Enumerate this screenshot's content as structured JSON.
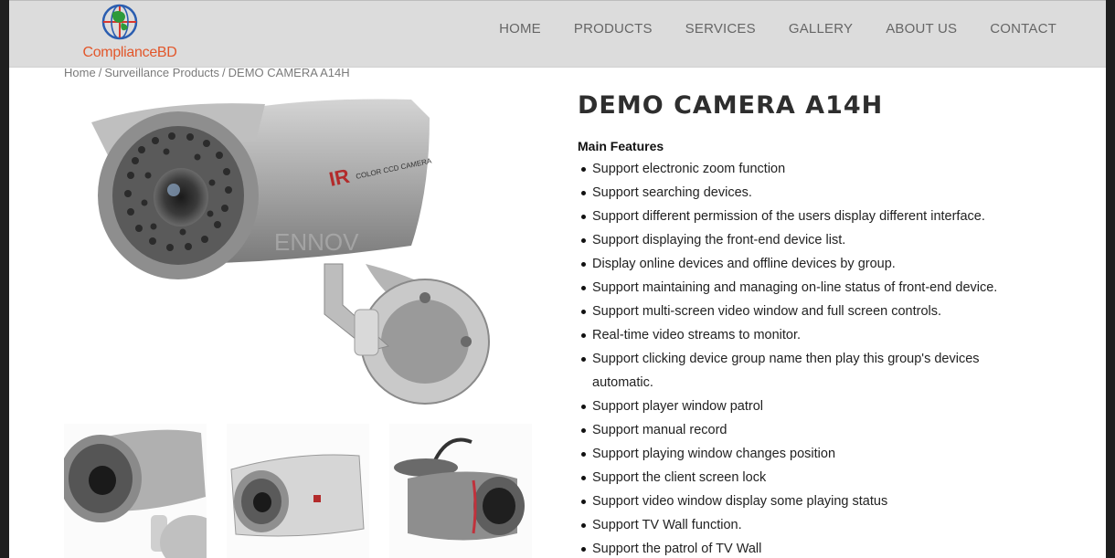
{
  "brand": {
    "name": "ComplianceBD"
  },
  "nav": [
    "HOME",
    "PRODUCTS",
    "SERVICES",
    "GALLERY",
    "ABOUT US",
    "CONTACT"
  ],
  "breadcrumb": {
    "home": "Home",
    "category": "Surveillance Products",
    "current": "DEMO CAMERA A14H",
    "separator": "/"
  },
  "product": {
    "title": "DEMO CAMERA A14H",
    "features_heading": "Main Features",
    "features": [
      "Support electronic zoom function",
      "Support searching devices.",
      "Support different permission of the users display different interface.",
      "Support displaying the front-end device list.",
      "Display online devices and offline devices by group.",
      "Support maintaining and managing on-line status of front-end device.",
      "Support multi-screen video window and full screen controls.",
      "Real-time video streams to monitor.",
      "Support clicking device group name then play this group's devices automatic.",
      "Support player window patrol",
      "Support manual record",
      "Support playing window changes position",
      "Support the client screen lock",
      "Support video window display some playing status",
      "Support TV Wall function.",
      "Support the patrol of TV Wall"
    ]
  },
  "image_text": {
    "camera_ir": "IR",
    "camera_label": "COLOR CCD CAMERA",
    "watermark": "ENNOV"
  },
  "colors": {
    "brand_orange": "#e2572b",
    "header_bg": "#dcdcdc",
    "title": "#2e2e2e"
  }
}
